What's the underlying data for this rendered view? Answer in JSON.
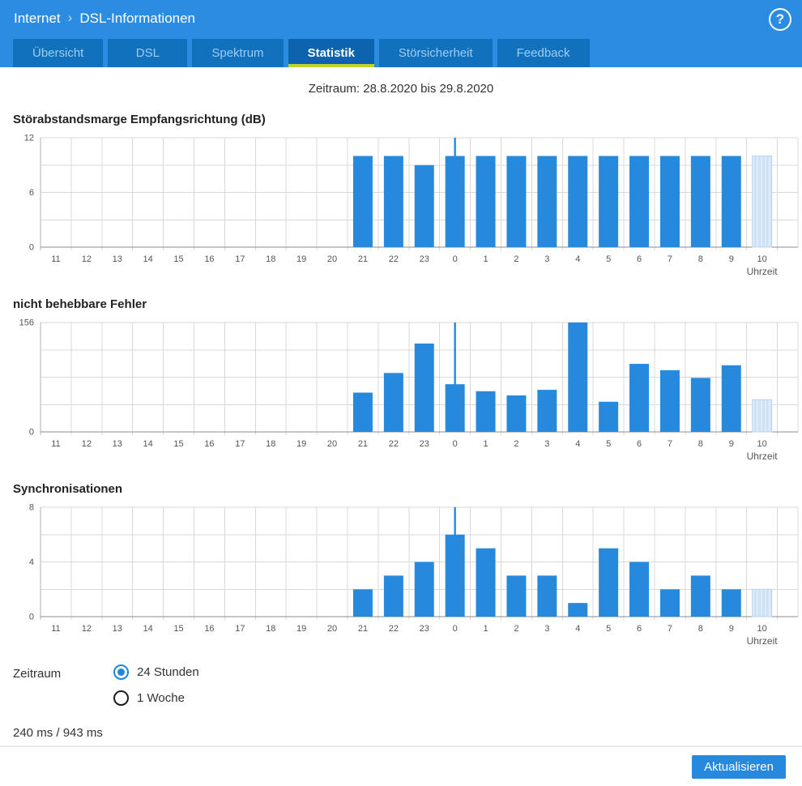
{
  "header": {
    "breadcrumb": {
      "section": "Internet",
      "separator": "›",
      "page": "DSL-Informationen"
    },
    "help_icon": "?",
    "tabs": [
      {
        "label": "Übersicht",
        "active": false
      },
      {
        "label": "DSL",
        "active": false
      },
      {
        "label": "Spektrum",
        "active": false
      },
      {
        "label": "Statistik",
        "active": true
      },
      {
        "label": "Störsicherheit",
        "active": false
      },
      {
        "label": "Feedback",
        "active": false
      }
    ]
  },
  "period_line": "Zeitraum: 28.8.2020 bis 29.8.2020",
  "chart_data": [
    {
      "type": "bar",
      "title": "Störabstandsmarge Empfangsrichtung (dB)",
      "xlabel": "Uhrzeit",
      "categories": [
        "11",
        "12",
        "13",
        "14",
        "15",
        "16",
        "17",
        "18",
        "19",
        "20",
        "21",
        "22",
        "23",
        "0",
        "1",
        "2",
        "3",
        "4",
        "5",
        "6",
        "7",
        "8",
        "9",
        "10"
      ],
      "values": [
        null,
        null,
        null,
        null,
        null,
        null,
        null,
        null,
        null,
        null,
        10,
        10,
        9,
        10,
        10,
        10,
        10,
        10,
        10,
        10,
        10,
        10,
        10,
        10
      ],
      "ylim": [
        0,
        12
      ],
      "grid_step": 3,
      "ytick_labels": [
        12,
        6,
        0
      ],
      "max_marker": {
        "category": "0",
        "value": 12
      },
      "last_bar_pending": true,
      "legend": "none",
      "grid": "on"
    },
    {
      "type": "bar",
      "title": "nicht behebbare Fehler",
      "xlabel": "Uhrzeit",
      "categories": [
        "11",
        "12",
        "13",
        "14",
        "15",
        "16",
        "17",
        "18",
        "19",
        "20",
        "21",
        "22",
        "23",
        "0",
        "1",
        "2",
        "3",
        "4",
        "5",
        "6",
        "7",
        "8",
        "9",
        "10"
      ],
      "values": [
        null,
        null,
        null,
        null,
        null,
        null,
        null,
        null,
        null,
        null,
        56,
        84,
        126,
        68,
        58,
        52,
        60,
        156,
        43,
        97,
        88,
        77,
        95,
        46
      ],
      "ylim": [
        0,
        156
      ],
      "grid_step": 39,
      "ytick_labels": [
        156,
        0
      ],
      "max_marker": {
        "category": "0",
        "value": 156
      },
      "last_bar_pending": true,
      "legend": "none",
      "grid": "on"
    },
    {
      "type": "bar",
      "title": "Synchronisationen",
      "xlabel": "Uhrzeit",
      "categories": [
        "11",
        "12",
        "13",
        "14",
        "15",
        "16",
        "17",
        "18",
        "19",
        "20",
        "21",
        "22",
        "23",
        "0",
        "1",
        "2",
        "3",
        "4",
        "5",
        "6",
        "7",
        "8",
        "9",
        "10"
      ],
      "values": [
        null,
        null,
        null,
        null,
        null,
        null,
        null,
        null,
        null,
        null,
        2,
        3,
        4,
        6,
        5,
        3,
        3,
        1,
        5,
        4,
        2,
        3,
        2,
        2
      ],
      "ylim": [
        0,
        8
      ],
      "grid_step": 2,
      "ytick_labels": [
        8,
        4,
        0
      ],
      "max_marker": {
        "category": "0",
        "value": 8
      },
      "last_bar_pending": true,
      "legend": "none",
      "grid": "on"
    }
  ],
  "zeitraum_control": {
    "label": "Zeitraum",
    "options": [
      {
        "label": "24 Stunden",
        "selected": true
      },
      {
        "label": "1 Woche",
        "selected": false
      }
    ]
  },
  "latency_text": "240 ms / 943 ms",
  "footer": {
    "refresh_label": "Aktualisieren"
  },
  "colors": {
    "header_blue": "#2b8ce2",
    "tab_blue": "#1171bc",
    "tab_active_blue": "#0c63ae",
    "tab_underline": "#bdd431",
    "bar_blue": "#2789db",
    "bar_pending_fill": "#cfe2f5",
    "bar_pending_stripe": "#dfecf9",
    "grid_line": "#d9d9d9",
    "axis_line": "#8c8c8c",
    "tick_text": "#555555",
    "radio_blue": "#1e86db"
  }
}
